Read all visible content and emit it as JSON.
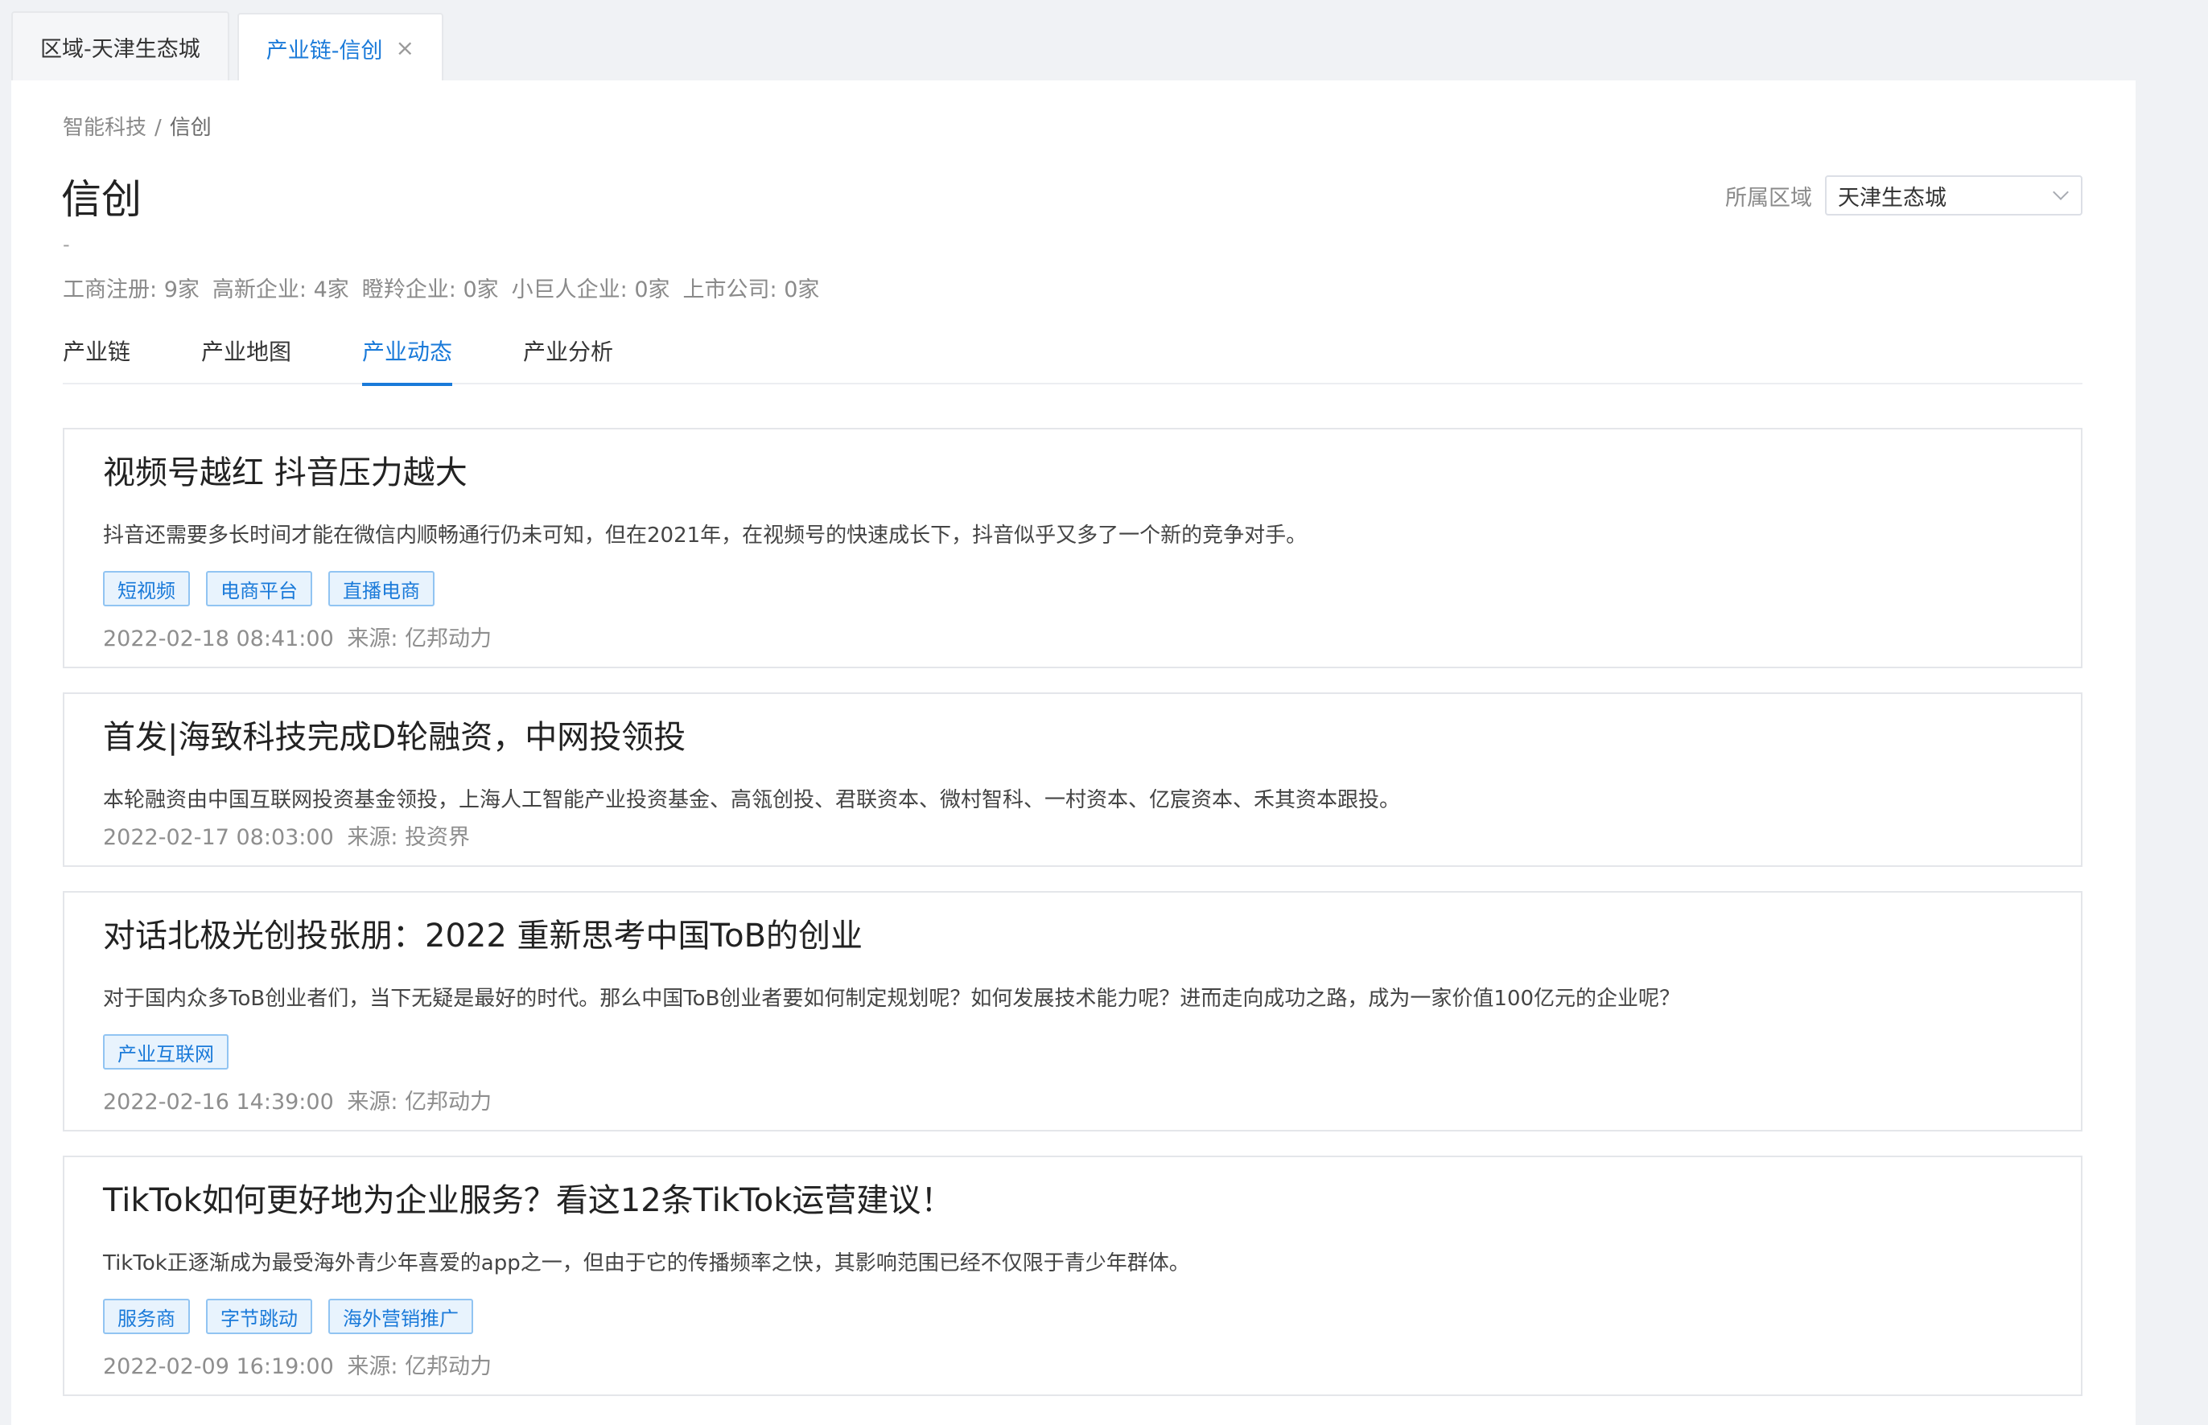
{
  "tabs": [
    {
      "label": "区域-天津生态城",
      "active": false
    },
    {
      "label": "产业链-信创",
      "active": true,
      "close": "×"
    }
  ],
  "breadcrumb": {
    "parent": "智能科技",
    "separator": "/",
    "current": "信创"
  },
  "title": "信创",
  "subtitle": "-",
  "stats": [
    {
      "label": "工商注册",
      "value": "9家"
    },
    {
      "label": "高新企业",
      "value": "4家"
    },
    {
      "label": "瞪羚企业",
      "value": "0家"
    },
    {
      "label": "小巨人企业",
      "value": "0家"
    },
    {
      "label": "上市公司",
      "value": "0家"
    }
  ],
  "region": {
    "label": "所属区域",
    "value": "天津生态城"
  },
  "subtabs": [
    {
      "label": "产业链",
      "active": false
    },
    {
      "label": "产业地图",
      "active": false
    },
    {
      "label": "产业动态",
      "active": true
    },
    {
      "label": "产业分析",
      "active": false
    }
  ],
  "source_label": "来源:",
  "news": [
    {
      "title": "视频号越红 抖音压力越大",
      "summary": "抖音还需要多长时间才能在微信内顺畅通行仍未可知，但在2021年，在视频号的快速成长下，抖音似乎又多了一个新的竞争对手。",
      "tags": [
        "短视频",
        "电商平台",
        "直播电商"
      ],
      "time": "2022-02-18 08:41:00",
      "source": "亿邦动力"
    },
    {
      "title": "首发|海致科技完成D轮融资，中网投领投",
      "summary": "本轮融资由中国互联网投资基金领投，上海人工智能产业投资基金、高瓴创投、君联资本、微村智科、一村资本、亿宸资本、禾其资本跟投。",
      "tags": [],
      "time": "2022-02-17 08:03:00",
      "source": "投资界"
    },
    {
      "title": "对话北极光创投张朋：2022 重新思考中国ToB的创业",
      "summary": "对于国内众多ToB创业者们，当下无疑是最好的时代。那么中国ToB创业者要如何制定规划呢？如何发展技术能力呢？进而走向成功之路，成为一家价值100亿元的企业呢？",
      "tags": [
        "产业互联网"
      ],
      "time": "2022-02-16 14:39:00",
      "source": "亿邦动力"
    },
    {
      "title": "TikTok如何更好地为企业服务？看这12条TikTok运营建议！",
      "summary": "TikTok正逐渐成为最受海外青少年喜爱的app之一，但由于它的传播频率之快，其影响范围已经不仅限于青少年群体。",
      "tags": [
        "服务商",
        "字节跳动",
        "海外营销推广"
      ],
      "time": "2022-02-09 16:19:00",
      "source": "亿邦动力"
    }
  ],
  "colors": {
    "accent": "#1a7ad9",
    "tag_bg": "#e8f3fd",
    "tag_border": "#91c4f2"
  }
}
